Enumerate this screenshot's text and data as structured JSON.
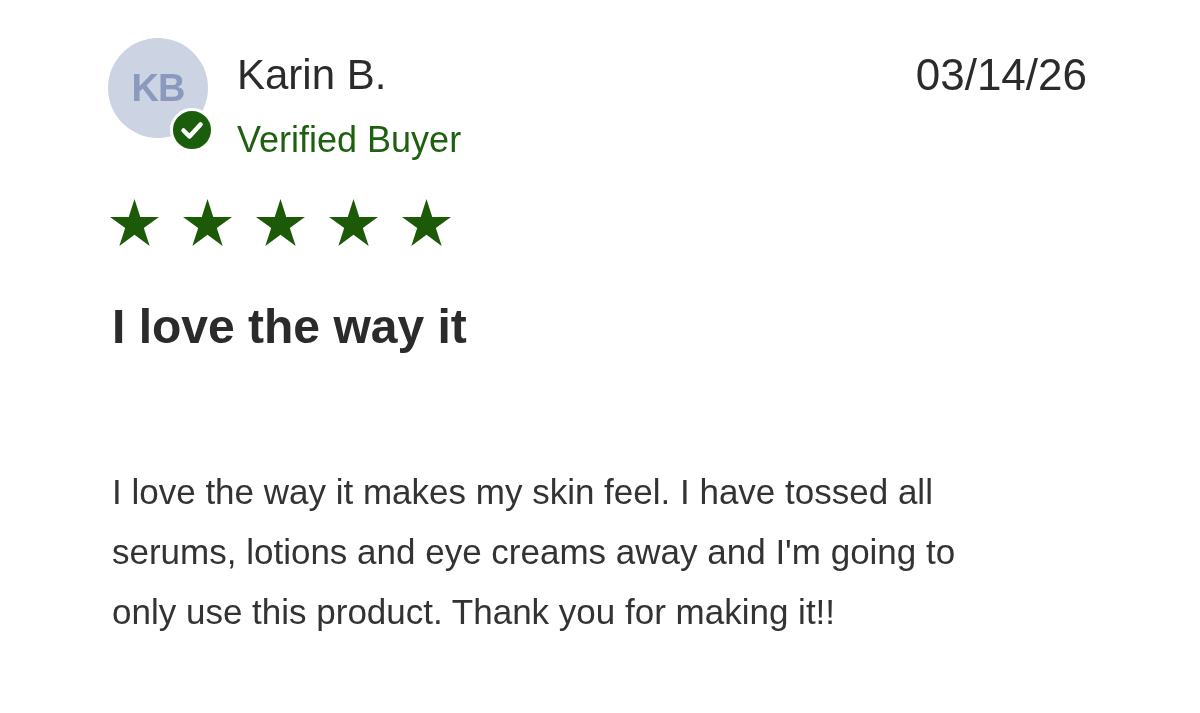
{
  "review": {
    "avatar_initials": "KB",
    "name": "Karin B.",
    "verified": true,
    "verified_label": "Verified Buyer",
    "date": "03/14/26",
    "stars": 5,
    "title": "I love the way it",
    "body": "I love the way it makes my skin feel. I have tossed all serums, lotions and eye creams away and I'm going to only use this product. Thank you for making it!!"
  }
}
